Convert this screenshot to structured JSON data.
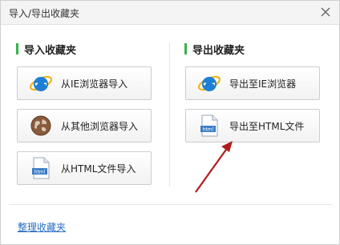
{
  "window": {
    "title": "导入/导出收藏夹"
  },
  "import_section": {
    "heading": "导入收藏夹",
    "buttons": [
      {
        "label": "从IE浏览器导入",
        "icon": "ie-icon"
      },
      {
        "label": "从其他浏览器导入",
        "icon": "globe-icon"
      },
      {
        "label": "从HTML文件导入",
        "icon": "html-file-icon"
      }
    ]
  },
  "export_section": {
    "heading": "导出收藏夹",
    "buttons": [
      {
        "label": "导出至IE浏览器",
        "icon": "ie-icon"
      },
      {
        "label": "导出至HTML文件",
        "icon": "html-file-icon"
      }
    ]
  },
  "footer": {
    "link_label": "整理收藏夹"
  },
  "colors": {
    "accent_bar": "#37b24d",
    "link": "#2a6fc4",
    "arrow": "#b01c1c",
    "ie_blue": "#1d7fd6",
    "ie_ring": "#f2b21b"
  }
}
